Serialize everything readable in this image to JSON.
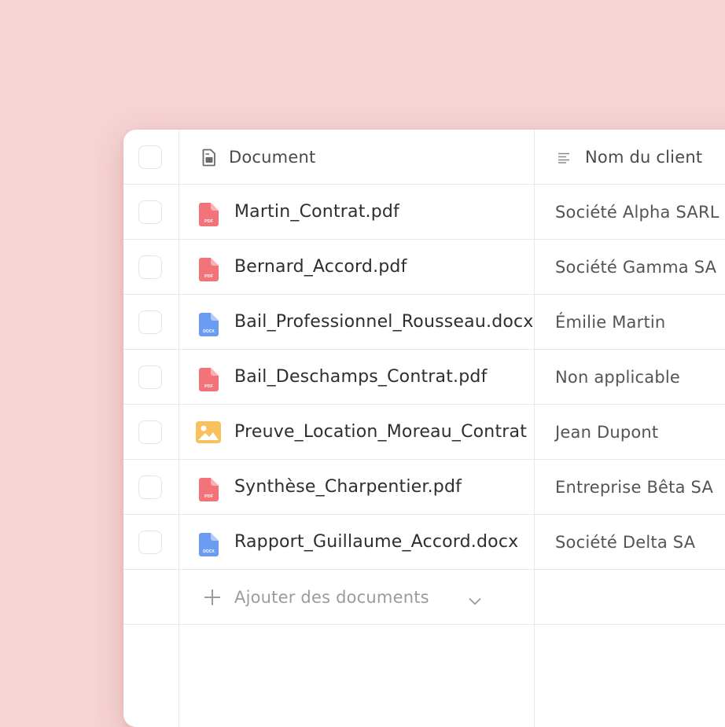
{
  "table": {
    "columns": {
      "document": {
        "label": "Document",
        "icon": "document-icon"
      },
      "client": {
        "label": "Nom du client",
        "icon": "text-lines-icon"
      }
    },
    "rows": [
      {
        "name": "Martin_Contrat.pdf",
        "type": "pdf",
        "client": "Société Alpha SARL"
      },
      {
        "name": "Bernard_Accord.pdf",
        "type": "pdf",
        "client": "Société Gamma SA"
      },
      {
        "name": "Bail_Professionnel_Rousseau.docx",
        "type": "docx",
        "client": "Émilie Martin"
      },
      {
        "name": "Bail_Deschamps_Contrat.pdf",
        "type": "pdf",
        "client": "Non applicable"
      },
      {
        "name": "Preuve_Location_Moreau_Contrat",
        "type": "image",
        "client": "Jean Dupont"
      },
      {
        "name": "Synthèse_Charpentier.pdf",
        "type": "pdf",
        "client": "Entreprise Bêta SA"
      },
      {
        "name": "Rapport_Guillaume_Accord.docx",
        "type": "docx",
        "client": "Société Delta SA"
      }
    ],
    "add_documents_label": "Ajouter des documents"
  },
  "icons": {
    "pdf_badge": "PDF",
    "docx_badge": "DOCX"
  },
  "colors": {
    "background": "#f6d4d4",
    "pdf": "#f27378",
    "docx": "#6a9cf2",
    "image": "#f8c15e"
  }
}
